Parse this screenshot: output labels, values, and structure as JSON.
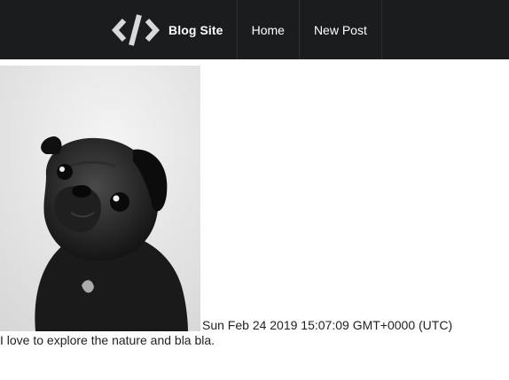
{
  "navbar": {
    "logo_icon": "code-icon",
    "brand": "Blog Site",
    "items": [
      {
        "label": "Home"
      },
      {
        "label": "New Post"
      }
    ]
  },
  "post": {
    "image_subject": "black pug dog portrait (black and white photo)",
    "date": "Sun Feb 24 2019 15:07:09 GMT+0000 (UTC)",
    "body": "I love to explore the nature and bla bla."
  }
}
